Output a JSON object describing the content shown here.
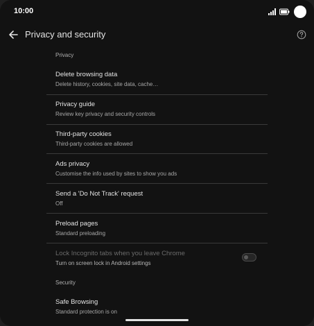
{
  "status_bar": {
    "time": "10:00",
    "icons": [
      "signal-icon",
      "battery-icon",
      "camera-cutout"
    ]
  },
  "app_bar": {
    "title": "Privacy and security",
    "back_icon": "arrow-back-icon",
    "help_icon": "help-icon"
  },
  "sections": {
    "privacy_header": "Privacy",
    "security_header": "Security"
  },
  "items": [
    {
      "title": "Delete browsing data",
      "subtitle": "Delete history, cookies, site data, cache…"
    },
    {
      "title": "Privacy guide",
      "subtitle": "Review key privacy and security controls"
    },
    {
      "title": "Third-party cookies",
      "subtitle": "Third-party cookies are allowed"
    },
    {
      "title": "Ads privacy",
      "subtitle": "Customise the info used by sites to show you ads"
    },
    {
      "title": "Send a 'Do Not Track' request",
      "subtitle": "Off"
    },
    {
      "title": "Preload pages",
      "subtitle": "Standard preloading"
    },
    {
      "title": "Lock Incognito tabs when you leave Chrome",
      "subtitle": "Turn on screen lock in Android settings",
      "toggle": "off",
      "disabled": true
    },
    {
      "title": "Safe Browsing",
      "subtitle": "Standard protection is on"
    }
  ],
  "colors": {
    "background": "#121212",
    "text": "#e3e3e3",
    "subtext": "#a8a8a8",
    "divider": "#3a3a3a"
  }
}
